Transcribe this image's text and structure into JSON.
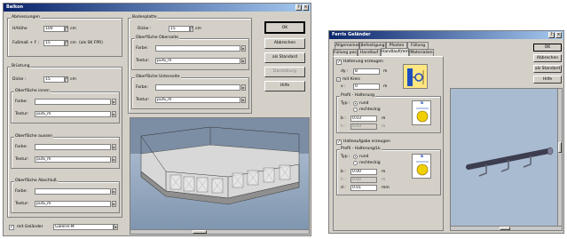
{
  "left": {
    "title": "Balkon",
    "title_buttons": [
      "?",
      "×"
    ],
    "abmessungen": {
      "title": "Abmessungen",
      "hoehe_label": "H/Höhe",
      "hoehe_value": "100",
      "hoehe_unit": "cm",
      "fuss_label": "Fußmaß + F :",
      "fuss_value": "15",
      "fuss_unit": "cm",
      "fuss_note": "(als SK FPR)"
    },
    "brueckung": {
      "title": "Brüstung",
      "dicke_label": "Dicke :",
      "dicke_value": "15",
      "dicke_unit": "cm",
      "innen": {
        "title": "Oberfläche innen",
        "farbe_label": "Farbe:",
        "farbe_value": "",
        "textur_label": "Textur:",
        "textur_value": "pulS_m"
      },
      "aussen": {
        "title": "Oberfläche aussen",
        "farbe_label": "Farbe:",
        "farbe_value": "",
        "textur_label": "Textur:",
        "textur_value": "pulS_m"
      },
      "abschluss": {
        "title": "Oberfläche Abschluß",
        "farbe_label": "Farbe:",
        "farbe_value": "",
        "textur_label": "Textur:",
        "textur_value": "pulS_m"
      }
    },
    "bodenplatte": {
      "title": "Bodenplatte",
      "dicke_label": "Dicke :",
      "dicke_value": "15",
      "dicke_unit": "cm",
      "oben": {
        "title": "Oberfläche Oberseite",
        "farbe_label": "Farbe:",
        "farbe_value": "",
        "textur_label": "Textur:",
        "textur_value": "pulS_m"
      },
      "unten": {
        "title": "Oberfläche Unterseite",
        "farbe_label": "Farbe:",
        "farbe_value": "",
        "textur_label": "Textur:",
        "textur_value": "pulS_m"
      }
    },
    "gelaender": {
      "label": "mit Geländer",
      "value": "Galerie-M",
      "checked": true
    },
    "buttons": {
      "ok": "OK",
      "abbrechen": "Abbrechen",
      "standard": "als Standard",
      "darstellung": "Darstellung",
      "hilfe": "Hilfe"
    }
  },
  "right": {
    "title": "Ferris Geländer",
    "title_buttons": [
      "?",
      "×"
    ],
    "tabs_row1": [
      "Allgemeines",
      "Befestigung",
      "Pfosten",
      "Füllung"
    ],
    "tabs_row2": [
      "Füllung pos.",
      "Handlauf",
      "Handlauf(mm)",
      "Materialien"
    ],
    "halterung": {
      "label": "Halterung erzeugen",
      "checked": true,
      "dy_label": "dy :",
      "dy_value": "8",
      "dy_unit": "m",
      "dz_label": "mit Kreis",
      "dz_checked": true,
      "v_label": "v :",
      "v_value": "0",
      "v_unit": "m"
    },
    "profil1": {
      "title": "Profil - Halterung",
      "typ_label": "Typ :",
      "rund_label": "rund",
      "rund_on": true,
      "eckig_label": "rechteckig",
      "eckig_on": false,
      "b_label": "b :",
      "b_value": "0.03",
      "b_unit": "m",
      "h_label": "h :",
      "h_value": "0.03",
      "h_unit": "m",
      "icon_b": "b"
    },
    "halteaufgabe": {
      "label": "Halteaufgabe erzeugen",
      "checked": true
    },
    "profil2": {
      "title": "Profil - Halterung/Lk",
      "typ_label": "Typ :",
      "rund_label": "rund",
      "rund_on": true,
      "eckig_label": "rechteckig",
      "eckig_on": false,
      "b_label": "b :",
      "b_value": "0.00",
      "b_unit": "m",
      "h_label": "h :",
      "h_value": "0.00",
      "h_unit": "m",
      "d_label": "d :",
      "d_value": "0.01",
      "d_unit": "mm",
      "icon_b": "b"
    },
    "buttons": {
      "ok": "OK",
      "abbrechen": "Abbrechen",
      "standard": "als Standard",
      "hilfe": "Hilfe"
    }
  }
}
